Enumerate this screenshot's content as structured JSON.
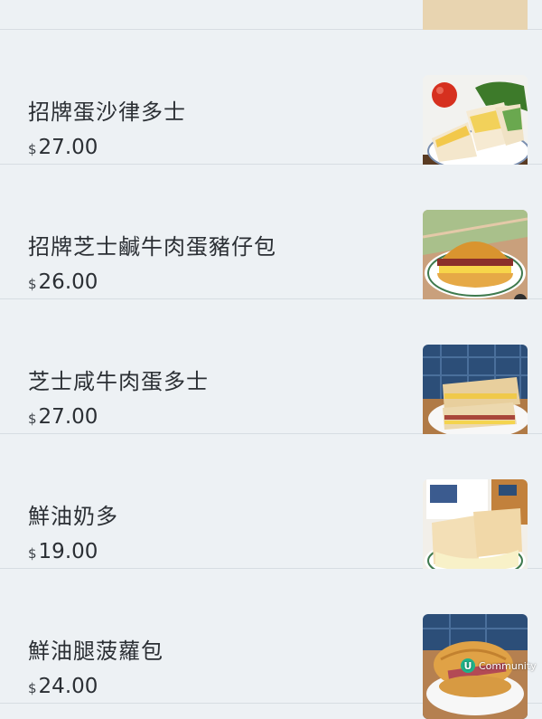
{
  "items": [
    {
      "name": "",
      "currency": "",
      "price": ""
    },
    {
      "name": "招牌蛋沙律多士",
      "currency": "$",
      "price": "27.00"
    },
    {
      "name": "招牌芝士鹹牛肉蛋豬仔包",
      "currency": "$",
      "price": "26.00"
    },
    {
      "name": "芝士咸牛肉蛋多士",
      "currency": "$",
      "price": "27.00"
    },
    {
      "name": "鮮油奶多",
      "currency": "$",
      "price": "19.00"
    },
    {
      "name": "鮮油腿菠蘿包",
      "currency": "$",
      "price": "24.00"
    }
  ],
  "watermark": {
    "badge": "U",
    "text": "Community"
  }
}
